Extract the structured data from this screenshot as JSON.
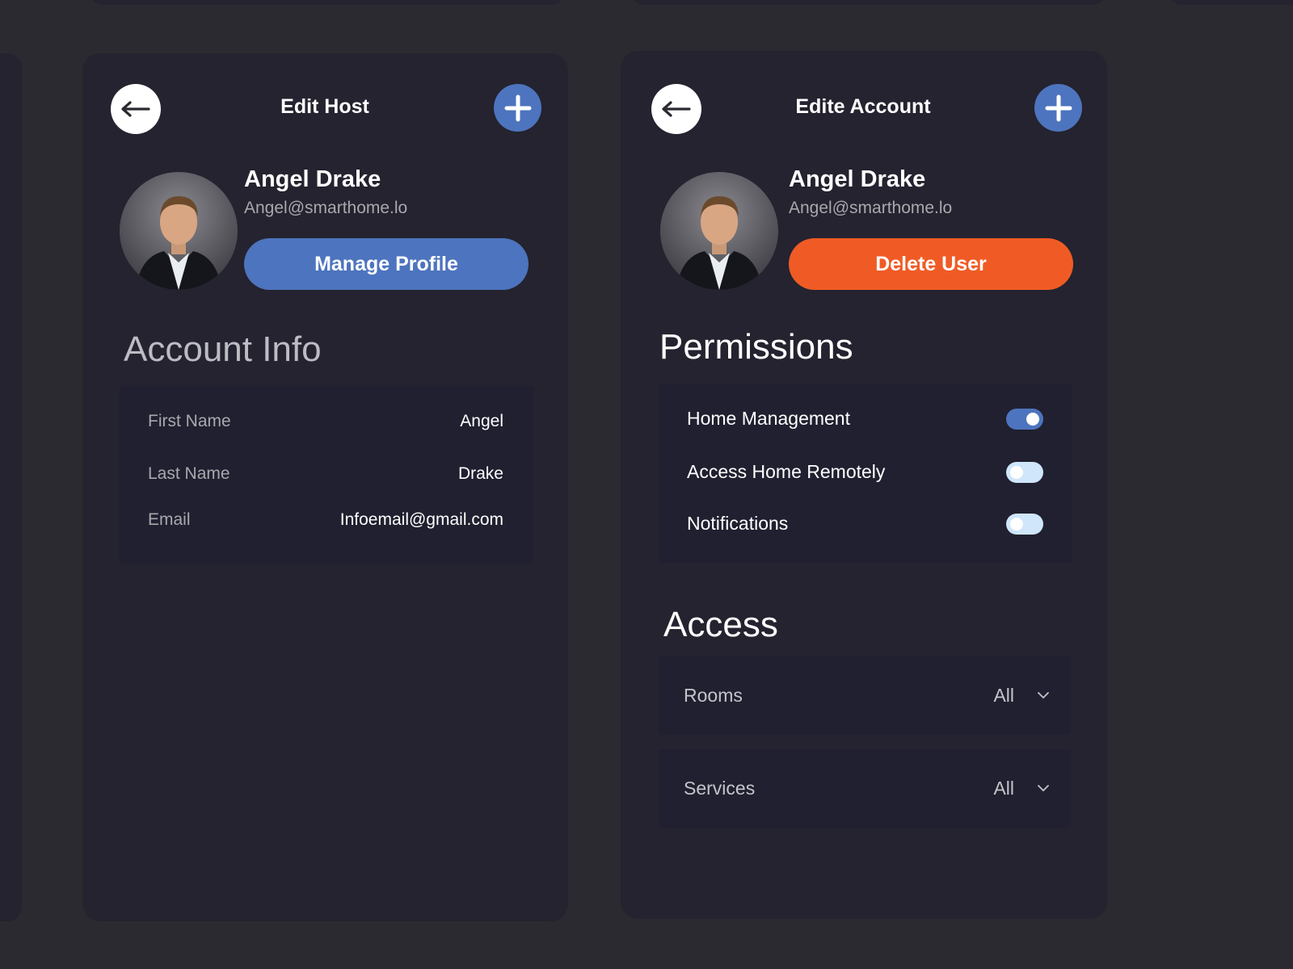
{
  "colors": {
    "background": "#2b2a30",
    "panel": "#24232f",
    "box": "#202030",
    "accent_blue": "#4d74be",
    "accent_orange": "#f05b25",
    "toggle_off": "#cfe6fb"
  },
  "edit_host": {
    "title": "Edit Host",
    "back_icon": "arrow-left-icon",
    "add_icon": "plus-icon",
    "user": {
      "name": "Angel Drake",
      "email": "Angel@smarthome.lo"
    },
    "manage_profile_label": "Manage Profile",
    "section_title": "Account Info",
    "fields": [
      {
        "label": "First Name",
        "value": "Angel"
      },
      {
        "label": "Last Name",
        "value": "Drake"
      },
      {
        "label": "Email",
        "value": "Infoemail@gmail.com"
      }
    ]
  },
  "edit_account": {
    "title": "Edite Account",
    "back_icon": "arrow-left-icon",
    "add_icon": "plus-icon",
    "user": {
      "name": "Angel Drake",
      "email": "Angel@smarthome.lo"
    },
    "delete_user_label": "Delete User",
    "permissions_title": "Permissions",
    "permissions": [
      {
        "label": "Home Management",
        "enabled": true
      },
      {
        "label": "Access Home Remotely",
        "enabled": false
      },
      {
        "label": "Notifications",
        "enabled": false
      }
    ],
    "access_title": "Access",
    "access": [
      {
        "label": "Rooms",
        "value": "All",
        "icon": "chevron-down-icon"
      },
      {
        "label": "Services",
        "value": "All",
        "icon": "chevron-down-icon"
      }
    ]
  }
}
